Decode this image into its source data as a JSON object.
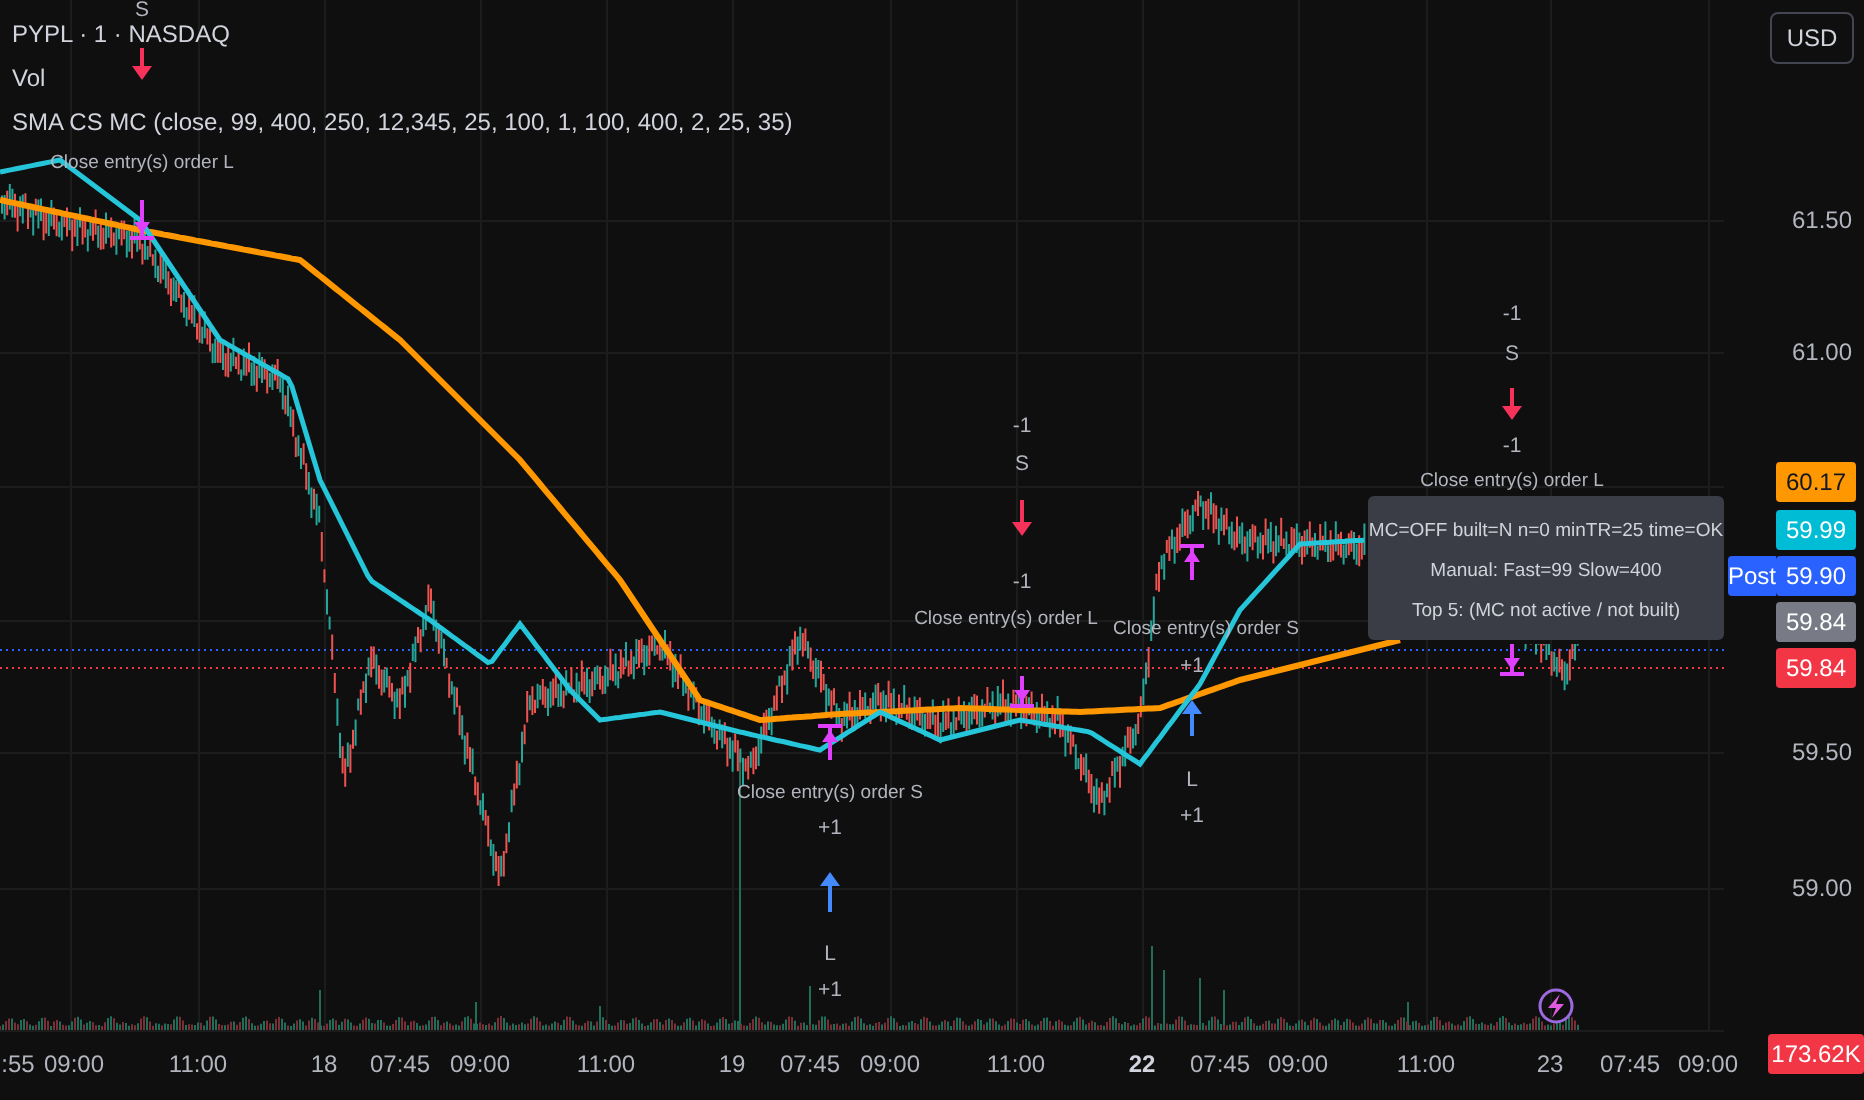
{
  "legend": {
    "symbol": "PYPL · 1 · NASDAQ",
    "volume": "Vol",
    "indicator": "SMA CS MC (close, 99, 400, 250, 12,345, 25, 100, 1, 100, 400, 2, 25, 35)"
  },
  "signals": [
    {
      "kind": "short",
      "texts": [
        "S"
      ]
    },
    {
      "kind": "close-long",
      "texts": [
        "Close entry(s) order L"
      ]
    },
    {
      "kind": "short",
      "texts": [
        "-1",
        "S"
      ]
    },
    {
      "kind": "close-long",
      "texts": [
        "-1",
        "Close entry(s) order L"
      ]
    },
    {
      "kind": "close-short",
      "texts": [
        "Close entry(s) order S",
        "+1"
      ]
    },
    {
      "kind": "long",
      "texts": [
        "L",
        "+1"
      ]
    },
    {
      "kind": "close-short",
      "texts": [
        "Close entry(s) order S",
        "+1"
      ]
    },
    {
      "kind": "long",
      "texts": [
        "L",
        "+1"
      ]
    },
    {
      "kind": "short",
      "texts": [
        "-1",
        "S"
      ]
    },
    {
      "kind": "close-long",
      "texts": [
        "-1",
        "Close entry(s) order L"
      ]
    }
  ],
  "tooltip": {
    "lines": [
      "MC=OFF built=N n=0 minTR=25 time=OK",
      "Manual: Fast=99  Slow=400",
      "Top 5: (MC not active / not built)"
    ]
  },
  "price_axis": {
    "currency_button": "USD",
    "ticks": [
      "61.50",
      "61.00",
      "59.50",
      "59.00"
    ],
    "tags": [
      {
        "text": "60.17",
        "color": "#ff9800"
      },
      {
        "text": "59.99",
        "color": "#00bcd4"
      },
      {
        "text": "59.90",
        "color": "#2962ff"
      },
      {
        "text": "59.84",
        "color": "#787b86"
      },
      {
        "text": "59.84",
        "color": "#f23645"
      }
    ],
    "session_tag": "Post",
    "volume_tag": {
      "text": "173.62K",
      "color": "#f23645"
    }
  },
  "time_axis": [
    {
      "label": ":55",
      "bold": false
    },
    {
      "label": "09:00",
      "bold": false
    },
    {
      "label": "11:00",
      "bold": false
    },
    {
      "label": "18",
      "bold": false
    },
    {
      "label": "07:45",
      "bold": false
    },
    {
      "label": "09:00",
      "bold": false
    },
    {
      "label": "11:00",
      "bold": false
    },
    {
      "label": "19",
      "bold": false
    },
    {
      "label": "07:45",
      "bold": false
    },
    {
      "label": "09:00",
      "bold": false
    },
    {
      "label": "11:00",
      "bold": false
    },
    {
      "label": "22",
      "bold": true
    },
    {
      "label": "07:45",
      "bold": false
    },
    {
      "label": "09:00",
      "bold": false
    },
    {
      "label": "11:00",
      "bold": false
    },
    {
      "label": "23",
      "bold": false
    },
    {
      "label": "07:45",
      "bold": false
    },
    {
      "label": "09:00",
      "bold": false
    }
  ]
}
